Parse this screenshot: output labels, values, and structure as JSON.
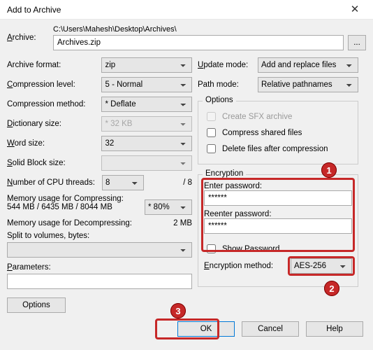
{
  "title": "Add to Archive",
  "archive": {
    "label": "Archive:",
    "path": "C:\\Users\\Mahesh\\Desktop\\Archives\\",
    "file": "Archives.zip",
    "browse": "..."
  },
  "left": {
    "format_label": "Archive format:",
    "format_value": "zip",
    "level_label": "Compression level:",
    "level_value": "5 - Normal",
    "method_label": "Compression method:",
    "method_value": "* Deflate",
    "dict_label": "Dictionary size:",
    "dict_value": "* 32 KB",
    "word_label": "Word size:",
    "word_value": "32",
    "block_label": "Solid Block size:",
    "block_value": "",
    "threads_label": "Number of CPU threads:",
    "threads_value": "8",
    "threads_total": "/ 8",
    "memc_label": "Memory usage for Compressing:",
    "memc_detail": "544 MB / 6435 MB / 8044 MB",
    "memc_combo": "* 80%",
    "memd_label": "Memory usage for Decompressing:",
    "memd_value": "2 MB",
    "split_label": "Split to volumes, bytes:",
    "params_label": "Parameters:",
    "options_btn": "Options"
  },
  "right": {
    "update_label": "Update mode:",
    "update_value": "Add and replace files",
    "path_label": "Path mode:",
    "path_value": "Relative pathnames",
    "options_legend": "Options",
    "sfx_label": "Create SFX archive",
    "shared_label": "Compress shared files",
    "delete_label": "Delete files after compression",
    "enc_legend": "Encryption",
    "pw_label": "Enter password:",
    "pw_value": "******",
    "pw2_label": "Reenter password:",
    "pw2_value": "******",
    "showpw_label": "Show Password",
    "encm_label": "Encryption method:",
    "encm_value": "AES-256"
  },
  "buttons": {
    "ok": "OK",
    "cancel": "Cancel",
    "help": "Help"
  },
  "annotations": {
    "a1": "1",
    "a2": "2",
    "a3": "3"
  }
}
